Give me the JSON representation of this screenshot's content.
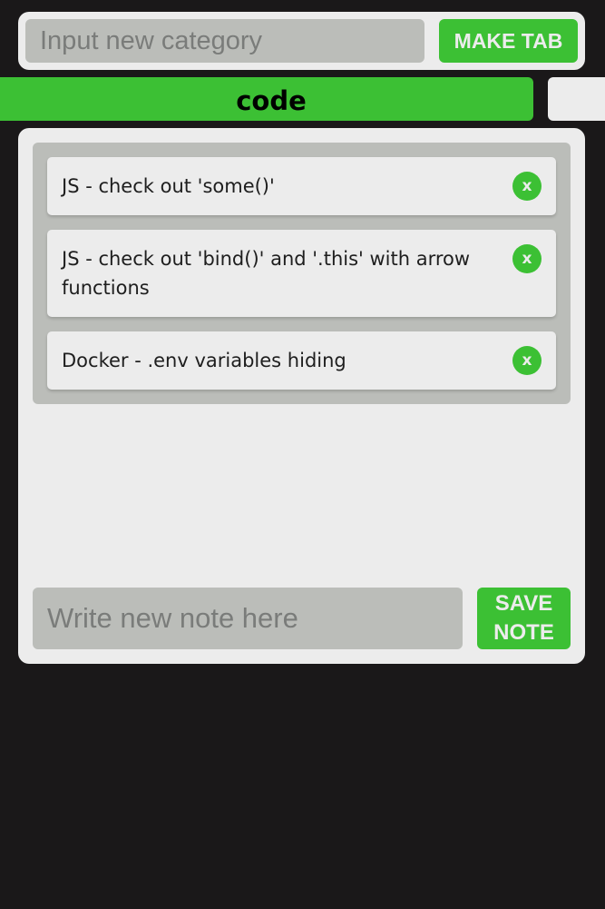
{
  "category_form": {
    "input_value": "",
    "input_placeholder": "Input new category",
    "button_label": "MAKE TAB"
  },
  "tabs": [
    {
      "label": "code",
      "active": true
    },
    {
      "label": "",
      "active": false
    }
  ],
  "notes": [
    {
      "text": "JS - check out 'some()'",
      "delete_label": "x"
    },
    {
      "text": "JS - check out 'bind()' and '.this' with arrow functions",
      "delete_label": "x"
    },
    {
      "text": "Docker - .env variables hiding",
      "delete_label": "x"
    }
  ],
  "note_form": {
    "input_value": "",
    "input_placeholder": "Write new note here",
    "button_label_line1": "SAVE",
    "button_label_line2": "NOTE"
  },
  "colors": {
    "background": "#1a1819",
    "panel": "#ececec",
    "field": "#bbbdb9",
    "accent": "#3cc034"
  }
}
